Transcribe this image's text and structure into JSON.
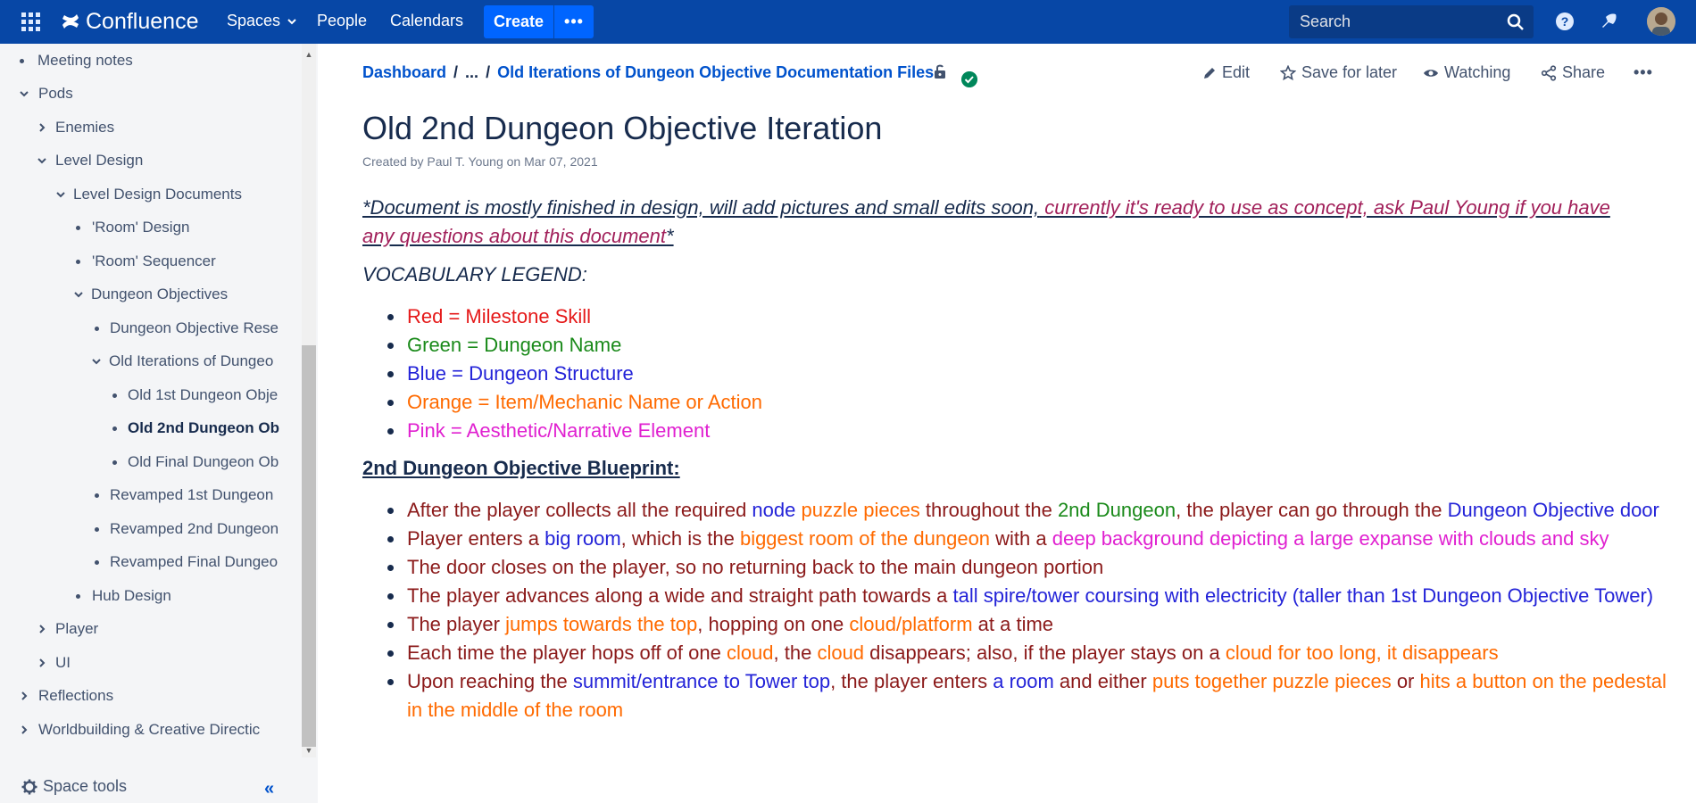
{
  "topnav": {
    "logo_text": "Confluence",
    "spaces": "Spaces",
    "people": "People",
    "calendars": "Calendars",
    "create": "Create",
    "more": "•••",
    "search_placeholder": "Search",
    "colors": {
      "bar": "#0747a6",
      "button": "#0065ff"
    }
  },
  "sidebar": {
    "items": [
      {
        "label": "Meeting notes"
      },
      {
        "label": "Pods"
      },
      {
        "label": "Enemies"
      },
      {
        "label": "Level Design"
      },
      {
        "label": "Level Design Documents"
      },
      {
        "label": "'Room' Design"
      },
      {
        "label": "'Room' Sequencer"
      },
      {
        "label": "Dungeon Objectives"
      },
      {
        "label": "Dungeon Objective Rese"
      },
      {
        "label": "Old Iterations of Dungeo"
      },
      {
        "label": "Old 1st Dungeon Obje"
      },
      {
        "label": "Old 2nd Dungeon Ob"
      },
      {
        "label": "Old Final Dungeon Ob"
      },
      {
        "label": "Revamped 1st Dungeon"
      },
      {
        "label": "Revamped 2nd Dungeon"
      },
      {
        "label": "Revamped Final Dungeo"
      },
      {
        "label": "Hub Design"
      },
      {
        "label": "Player"
      },
      {
        "label": "UI"
      },
      {
        "label": "Reflections"
      },
      {
        "label": "Worldbuilding & Creative Directic"
      }
    ],
    "space_tools": "Space tools",
    "collapse": "«"
  },
  "breadcrumb": {
    "dashboard": "Dashboard",
    "sep": "/",
    "ellipsis": "...",
    "parent": "Old Iterations of Dungeon Objective Documentation Files"
  },
  "actions": {
    "edit": "Edit",
    "save_for_later": "Save for later",
    "watching": "Watching",
    "share": "Share",
    "more": "•••"
  },
  "page": {
    "title": "Old 2nd Dungeon Objective Iteration",
    "byline": "Created by Paul T. Young on Mar 07, 2021",
    "intro_a": "*Document is mostly finished in design, will add pictures and small edits soon,",
    "intro_b": " currently it's ready to use as concept, ask Paul Young if you have any questions about this document",
    "intro_c": "*",
    "vocab_title": "VOCABULARY LEGEND:",
    "vocab": [
      "Red = Milestone Skill",
      "Green = Dungeon Name",
      "Blue = Dungeon Structure",
      "Orange = Item/Mechanic Name or Action",
      "Pink = Aesthetic/Narrative Element"
    ],
    "blueprint_title": "2nd Dungeon Objective Blueprint:",
    "b1": [
      "After the player collects all the required ",
      "node",
      " ",
      "puzzle pieces",
      " throughout the ",
      "2nd Dungeon",
      ", the player can go through the ",
      "Dungeon Objective door"
    ],
    "b2": [
      "Player enters a ",
      "big room",
      ", which is the ",
      "biggest room of the dungeon",
      " with a ",
      "deep background depicting a large expanse with clouds and sky"
    ],
    "b3": [
      "The door closes on the player, so no returning back to the main dungeon portion"
    ],
    "b4": [
      "The player advances along a wide and straight path towards a ",
      "tall spire/tower coursing with electricity (taller than 1st Dungeon Objective Tower)"
    ],
    "b5": [
      "The player ",
      "jumps towards the top",
      ", hopping on one ",
      "cloud/platform",
      " at a time"
    ],
    "b6": [
      "Each time the player hops off of one ",
      "cloud",
      ", the ",
      "cloud",
      " disappears; also, if the player stays on a ",
      "cloud for too long, it disappears"
    ],
    "b7": [
      "Upon reaching the ",
      "summit/entrance to Tower top",
      ", the player enters ",
      "a room",
      " and either ",
      "puts together puzzle pieces",
      " or ",
      "hits a button on the pedestal in the middle of the room"
    ],
    "colors": {
      "red": "#e51a1a",
      "green": "#1a8a1a",
      "blue": "#2323d8",
      "orange": "#ff6a00",
      "pink": "#e020d0",
      "body": "#8b1a1a"
    }
  }
}
